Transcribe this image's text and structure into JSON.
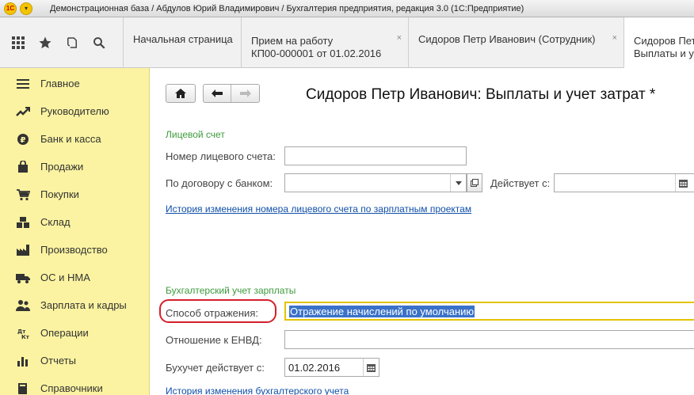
{
  "window": {
    "title": "Демонстрационная база / Абдулов Юрий Владимирович / Бухгалтерия предприятия, редакция 3.0  (1С:Предприятие)"
  },
  "tabs": [
    {
      "label": "Начальная страница"
    },
    {
      "label_line1": "Прием на работу",
      "label_line2": "КП00-000001 от 01.02.2016",
      "close": "×"
    },
    {
      "label": "Сидоров Петр Иванович (Сотрудник)",
      "close": "×"
    },
    {
      "label_line1": "Сидоров Петр",
      "label_line2": "Выплаты и у"
    }
  ],
  "sidebar": {
    "items": [
      {
        "label": "Главное",
        "icon": "menu-lines-icon"
      },
      {
        "label": "Руководителю",
        "icon": "trend-icon"
      },
      {
        "label": "Банк и касса",
        "icon": "coin-icon"
      },
      {
        "label": "Продажи",
        "icon": "bag-icon"
      },
      {
        "label": "Покупки",
        "icon": "cart-icon"
      },
      {
        "label": "Склад",
        "icon": "boxes-icon"
      },
      {
        "label": "Производство",
        "icon": "factory-icon"
      },
      {
        "label": "ОС и НМА",
        "icon": "truck-icon"
      },
      {
        "label": "Зарплата и кадры",
        "icon": "people-icon"
      },
      {
        "label": "Операции",
        "icon": "dt-kt-icon"
      },
      {
        "label": "Отчеты",
        "icon": "chart-icon"
      },
      {
        "label": "Справочники",
        "icon": "book-icon"
      }
    ]
  },
  "form": {
    "title": "Сидоров Петр Иванович: Выплаты и учет затрат *",
    "group_account": "Лицевой счет",
    "account_number_label": "Номер лицевого счета:",
    "account_number_value": "",
    "bank_contract_label": "По договору с банком:",
    "bank_contract_value": "",
    "valid_from_label": "Действует с:",
    "valid_from_value": "",
    "account_history_link": "История изменения номера лицевого счета по зарплатным проектам",
    "group_accounting": "Бухгалтерский учет зарплаты",
    "reflection_method_label": "Способ отражения:",
    "reflection_method_value": "Отражение начислений по умолчанию",
    "envd_label": "Отношение к ЕНВД:",
    "envd_value": "",
    "accounting_from_label": "Бухучет действует с:",
    "accounting_from_value": "01.02.2016",
    "accounting_history_link": "История изменения бухгалтерского учета"
  },
  "colors": {
    "sidebar_bg": "#fbf3a1",
    "group_title": "#3c9b3c",
    "link": "#0f4fa8",
    "focus_border": "#e3c400",
    "highlight": "#d41f2b",
    "selection": "#3a72c9"
  }
}
